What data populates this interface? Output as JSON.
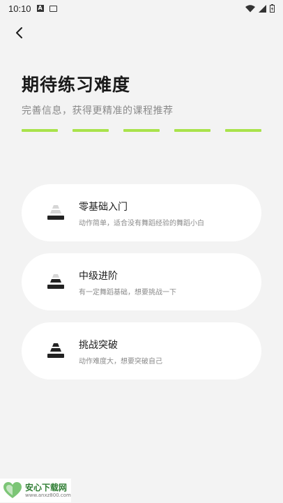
{
  "status_bar": {
    "time": "10:10"
  },
  "header": {
    "title": "期待练习难度",
    "subtitle": "完善信息，获得更精准的课程推荐"
  },
  "progress": {
    "total_steps": 5,
    "completed_steps": 5,
    "color": "#a9e34b"
  },
  "options": [
    {
      "title": "零基础入门",
      "desc": "动作简单，适合没有舞蹈经验的舞蹈小白",
      "level": 1
    },
    {
      "title": "中级进阶",
      "desc": "有一定舞蹈基础，想要挑战一下",
      "level": 2
    },
    {
      "title": "挑战突破",
      "desc": "动作难度大，想要突破自己",
      "level": 3
    }
  ],
  "watermark": {
    "main": "安心下载网",
    "sub": "www.anxz800.com"
  },
  "colors": {
    "background": "#f3f3f3",
    "card": "#ffffff",
    "accent": "#a9e34b",
    "level_active": "#222222",
    "level_inactive": "#d6d6d6"
  }
}
